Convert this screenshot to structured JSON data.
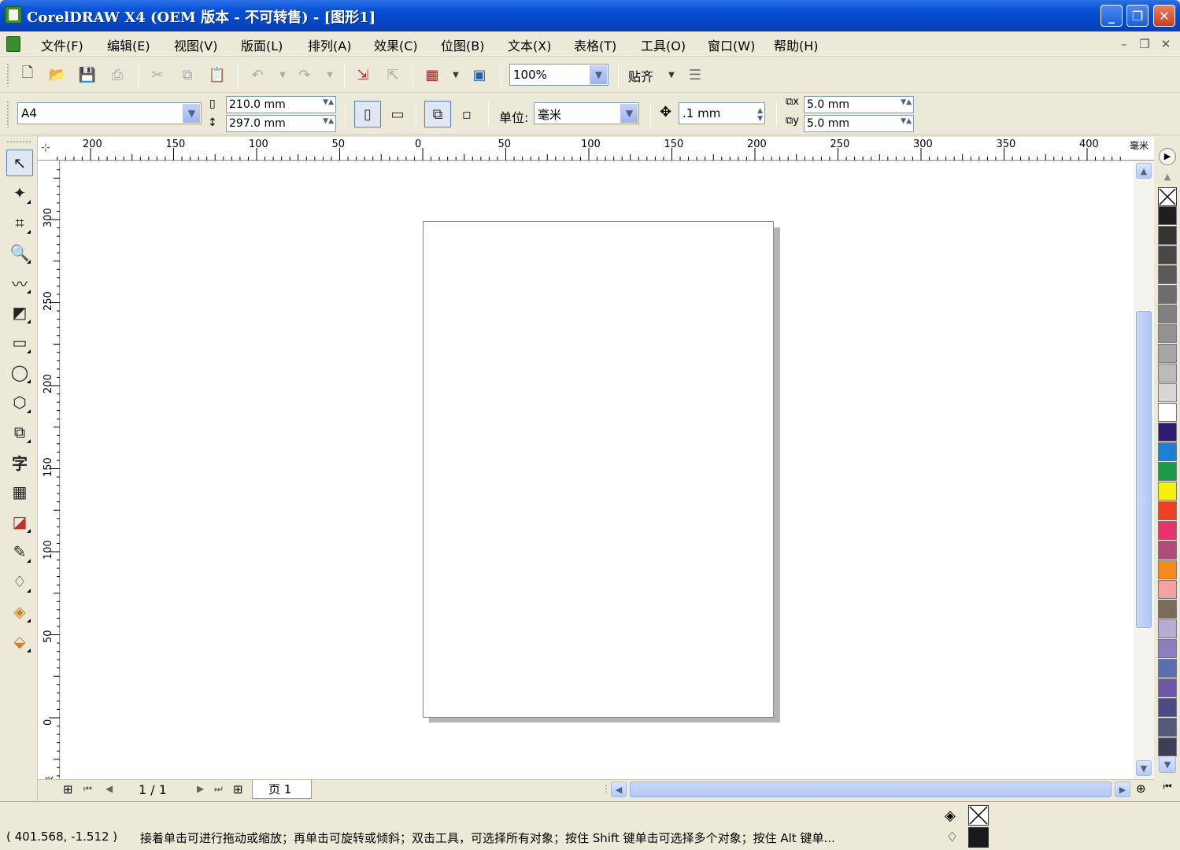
{
  "window": {
    "title": "CorelDRAW X4 (OEM 版本 - 不可转售) - [图形1]",
    "minimize": "_",
    "restore": "❐",
    "close": "✕"
  },
  "menu": {
    "items": [
      {
        "label": "文件(F)"
      },
      {
        "label": "编辑(E)"
      },
      {
        "label": "视图(V)"
      },
      {
        "label": "版面(L)"
      },
      {
        "label": "排列(A)"
      },
      {
        "label": "效果(C)"
      },
      {
        "label": "位图(B)"
      },
      {
        "label": "文本(X)"
      },
      {
        "label": "表格(T)"
      },
      {
        "label": "工具(O)"
      },
      {
        "label": "窗口(W)"
      },
      {
        "label": "帮助(H)"
      }
    ]
  },
  "toolbar": {
    "zoom_value": "100%",
    "snap_label": "贴齐"
  },
  "propbar": {
    "page_size": "A4",
    "width": "210.0 mm",
    "height": "297.0 mm",
    "unit_label": "单位:",
    "unit_value": "毫米",
    "nudge": ".1 mm",
    "dup_x": "5.0 mm",
    "dup_y": "5.0 mm"
  },
  "rulers": {
    "top_labels": [
      "200",
      "150",
      "100",
      "50",
      "0",
      "50",
      "100",
      "150",
      "200",
      "250",
      "300",
      "350",
      "400"
    ],
    "top_unit": "毫米",
    "left_labels": [
      "300",
      "250",
      "200",
      "150",
      "100",
      "50",
      "0"
    ],
    "left_unit": "毫米"
  },
  "pages": {
    "counter": "1 / 1",
    "tab_label": "页 1"
  },
  "status": {
    "coords": "( 401.568, -1.512 )",
    "hint": "接着单击可进行拖动或缩放；再单击可旋转或倾斜；双击工具，可选择所有对象；按住 Shift 键单击可选择多个对象；按住 Alt 键单..."
  },
  "palette": {
    "colors": [
      "#1f1f1f",
      "#333333",
      "#474747",
      "#5a5a5a",
      "#6d6d6d",
      "#808080",
      "#939393",
      "#a6a6a6",
      "#bababa",
      "#d6d6d6",
      "#ffffff",
      "#2e1a6e",
      "#1e7fd6",
      "#1a9a4a",
      "#f8ef10",
      "#ef4023",
      "#e8326e",
      "#b04a79",
      "#f58a1f",
      "#f6a0a0",
      "#7d6a5e",
      "#b6acd6",
      "#8b80bd",
      "#5a6fb0",
      "#6b58a8",
      "#4b4a86",
      "#515a7a",
      "#3e3e5a"
    ]
  }
}
